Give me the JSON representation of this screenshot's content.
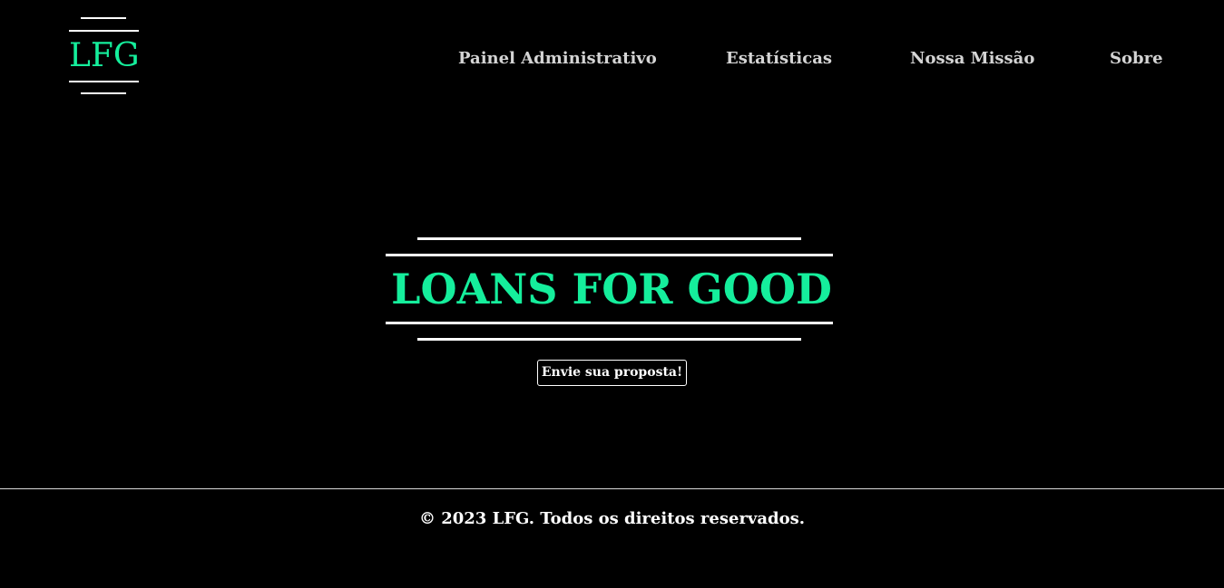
{
  "header": {
    "logo_text": "LFG",
    "nav": [
      {
        "label": "Painel Administrativo"
      },
      {
        "label": "Estatísticas"
      },
      {
        "label": "Nossa Missão"
      },
      {
        "label": "Sobre"
      }
    ]
  },
  "hero": {
    "title": "LOANS FOR GOOD",
    "cta_label": "Envie sua proposta!"
  },
  "footer": {
    "copyright": "© 2023 LFG. Todos os direitos reservados."
  },
  "colors": {
    "background": "#000000",
    "accent": "#15ee9c",
    "nav_text": "#d4d4d4",
    "text": "#ffffff"
  }
}
